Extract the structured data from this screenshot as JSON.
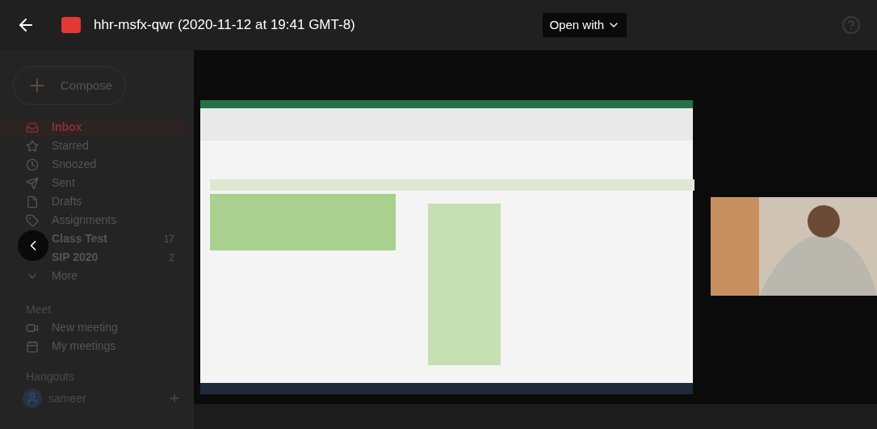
{
  "header": {
    "title": "hhr-msfx-qwr (2020-11-12 at 19:41 GMT-8)",
    "open_with": "Open with"
  },
  "sidebar": {
    "compose": "Compose",
    "items": [
      {
        "label": "Inbox",
        "selected": true,
        "unread": true
      },
      {
        "label": "Starred",
        "selected": false,
        "unread": false
      },
      {
        "label": "Snoozed",
        "selected": false,
        "unread": false
      },
      {
        "label": "Sent",
        "selected": false,
        "unread": false
      },
      {
        "label": "Drafts",
        "selected": false,
        "unread": false
      },
      {
        "label": "Assignments",
        "selected": false,
        "unread": false
      },
      {
        "label": "Class Test",
        "count": "17",
        "selected": false,
        "unread": true
      },
      {
        "label": "SIP 2020",
        "count": "2",
        "selected": false,
        "unread": true
      },
      {
        "label": "More",
        "selected": false,
        "unread": false
      }
    ],
    "meet": {
      "heading": "Meet",
      "items": [
        {
          "label": "New meeting"
        },
        {
          "label": "My meetings"
        }
      ]
    },
    "hangouts": {
      "heading": "Hangouts",
      "user": "sameer"
    }
  }
}
